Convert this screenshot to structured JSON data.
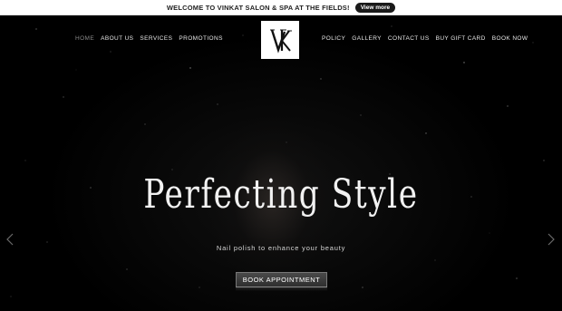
{
  "announcement": {
    "text": "WELCOME TO VINKAT SALON & SPA AT THE FIELDS!",
    "button_label": "View more"
  },
  "nav": {
    "left": [
      "HOME",
      "ABOUT US",
      "SERVICES",
      "PROMOTIONS"
    ],
    "right": [
      "POLICY",
      "GALLERY",
      "CONTACT US",
      "BUY GIFT CARD",
      "BOOK NOW"
    ],
    "active": "HOME"
  },
  "logo": {
    "monogram": "VK"
  },
  "hero": {
    "headline": "Perfecting Style",
    "subtitle": "Nail polish to enhance your beauty",
    "cta_label": "BOOK APPOINTMENT"
  },
  "carousel": {
    "prev_icon": "chevron-left-icon",
    "next_icon": "chevron-right-icon"
  },
  "colors": {
    "background": "#000000",
    "announcement_bg": "#ffffff",
    "nav_text": "#e8e8e8",
    "nav_active": "#8a8a8a"
  }
}
